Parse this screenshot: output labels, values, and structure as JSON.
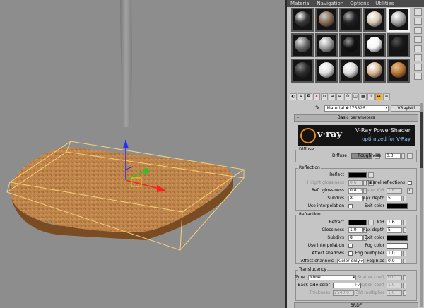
{
  "menu": [
    "Material",
    "Navigation",
    "Options",
    "Utilities"
  ],
  "material_name": "Material #173826",
  "material_type": "VRayMtl",
  "rollout_title": "Basic parameters",
  "banner": {
    "logo": "v·ray",
    "title": "V-Ray PowerShader",
    "subtitle": "optimized for V-Ray"
  },
  "slots": [
    {
      "color": "#3a3a3a",
      "hl": "#ffffff",
      "icon": "dark-glossy-sphere"
    },
    {
      "color": "#8b6e59",
      "hl": "#cfcfcf",
      "icon": "checker-sphere"
    },
    {
      "color": "#222222",
      "hl": "#b5b5b5",
      "icon": "dark-sphere"
    },
    {
      "color": "#d8c8b4",
      "hl": "#ffffff",
      "icon": "cream-sphere"
    },
    {
      "color": "#a7a7a7",
      "hl": "#ffffff",
      "icon": "chrome-sphere"
    },
    {
      "color": "#6d6d6d",
      "hl": "#e8e8e8",
      "icon": "metal-sphere"
    },
    {
      "color": "#9f9f9f",
      "hl": "#ffffff",
      "icon": "marble-sphere"
    },
    {
      "color": "#111111",
      "hl": "#999999",
      "icon": "black-sphere"
    },
    {
      "color": "#f6f6f6",
      "hl": "#ffffff",
      "icon": "white-sphere"
    },
    {
      "color": "#1a1a1a",
      "hl": "#555555",
      "icon": "empty-sphere"
    },
    {
      "color": "#2e2e2e",
      "hl": "#888888",
      "icon": "tile-sphere"
    },
    {
      "color": "#e0e0e0",
      "hl": "#ffffff",
      "icon": "silver-sphere"
    },
    {
      "color": "#dcdcdc",
      "hl": "#ffffff",
      "icon": "light-sphere"
    },
    {
      "color": "#d8b894",
      "hl": "#ffffff",
      "icon": "beige-sphere"
    },
    {
      "color": "#b8763a",
      "hl": "#e5c08a",
      "icon": "cork-sphere"
    }
  ],
  "diffuse": {
    "group": "Diffuse",
    "label": "Diffuse",
    "map_btn": "M",
    "roughness_label": "Roughness",
    "roughness": "0.0",
    "swatch": "#8a8a8a"
  },
  "reflection": {
    "group": "Reflection",
    "reflect_label": "Reflect",
    "reflect_color": "#000000",
    "hilight_label": "Hilight glossiness",
    "hilight": "0.6",
    "lock": "L",
    "fresnel_label": "Fresnel reflections",
    "refl_gloss_label": "Refl. glossiness",
    "refl_gloss": "0.8",
    "fresnel_ior_label": "Fresnel IOR",
    "fresnel_ior": "1.6",
    "fresnel_lock": "L",
    "subdivs_label": "Subdivs",
    "subdivs": "8",
    "max_depth_label": "Max depth",
    "max_depth": "5",
    "interp_label": "Use interpolation",
    "exit_label": "Exit color",
    "exit_color": "#000000"
  },
  "refraction": {
    "group": "Refraction",
    "refract_label": "Refract",
    "refract_color": "#000000",
    "ior_label": "IOR",
    "ior": "1.6",
    "gloss_label": "Glossiness",
    "gloss": "1.0",
    "max_depth_label": "Max depth",
    "max_depth": "5",
    "subdivs_label": "Subdivs",
    "subdivs": "8",
    "exit_label": "Exit color",
    "exit_color": "#000000",
    "interp_label": "Use interpolation",
    "fog_color_label": "Fog color",
    "fog_color": "#ffffff",
    "shadows_label": "Affect shadows",
    "fog_mult_label": "Fog multiplier",
    "fog_mult": "1.0",
    "channels_label": "Affect channels",
    "channels": "Color only",
    "fog_bias_label": "Fog bias",
    "fog_bias": "0.0"
  },
  "translucency": {
    "group": "Translucency",
    "type_label": "Type",
    "type": "None",
    "scatter_label": "Scatter coeff",
    "scatter": "0.0",
    "back_label": "Back-side color",
    "fwd_label": "Fwd/bck coeff",
    "fwd": "1.0",
    "thickness_label": "Thickness",
    "thickness": "2540.0",
    "light_label": "Light multiplier",
    "light": "1.0"
  },
  "next_rollout": "BRDF"
}
